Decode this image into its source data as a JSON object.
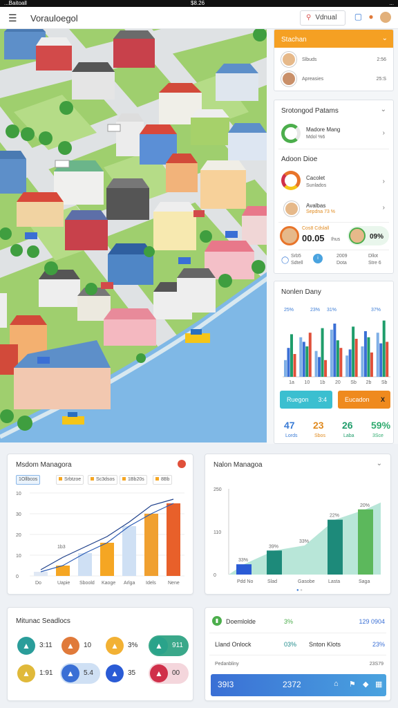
{
  "status": {
    "left": "...Baitoall",
    "center": "$8.26",
    "right": "..."
  },
  "appbar": {
    "title": "Vorauloegol",
    "search_label": "Vdnual",
    "menu_icon": "hamburger-icon",
    "search_icon": "search-icon"
  },
  "side": {
    "card1": {
      "title": "Stachan",
      "rows": [
        {
          "label": "Slbuds",
          "value": "2:56"
        },
        {
          "label": "Apreasies",
          "value": "25:S"
        }
      ]
    },
    "card2": {
      "title": "Srotongod Patams",
      "title2": "Adoon Dioe",
      "rows": [
        {
          "l1": "Madore Mang",
          "l2": "Mdol %6"
        },
        {
          "l1": "Cacolet",
          "l2": "Sunlados"
        },
        {
          "l1": "Avalbas",
          "l2": "Sepdna 73 %"
        }
      ],
      "time_label": "Cos8 Cdslall",
      "time_value": "00.05",
      "time_unit": "Ihus",
      "pct": "09%",
      "foot": [
        "Srb5",
        "Sdtell",
        "2009",
        "Dota",
        "Dllot",
        "Stre 6"
      ]
    },
    "card3": {
      "title": "Nonlen Dany",
      "toplabels": [
        "25%",
        "23%",
        "31%",
        "37%"
      ],
      "xlabels": [
        "1a",
        "10",
        "1b",
        "20",
        "Sb",
        "2b",
        "Sb"
      ],
      "btn1": "Ruegon",
      "btn1_val": "3:4",
      "btn2": "Eucadon",
      "btn2_val": "X",
      "stats": [
        {
          "num": "47",
          "lbl": "Lords",
          "color": "#3a7bd5"
        },
        {
          "num": "23",
          "lbl": "Sbos",
          "color": "#e08a1e"
        },
        {
          "num": "26",
          "lbl": "Laba",
          "color": "#1f9d6b"
        },
        {
          "num": "59%",
          "lbl": "3Sce",
          "color": "#2eaa6e"
        }
      ]
    }
  },
  "panel1": {
    "title": "Msdom Managora",
    "filters": [
      "1Ollbcos",
      "Srbtzoe",
      "Sc3dsos",
      "1Bb20s",
      "8Bb"
    ],
    "yticks": [
      "10",
      "30",
      "20",
      "10",
      "0"
    ],
    "categories": [
      "Do",
      "Uapie",
      "Sboold",
      "Kaoge",
      "Arlga",
      "Idels",
      "Nene"
    ],
    "datalabel": "1b3"
  },
  "panel2": {
    "title": "Nalon Managoa",
    "yticks": [
      "250",
      "110",
      "0"
    ],
    "categories": [
      "Pdd No",
      "Slad",
      "Gasobe",
      "Lasta",
      "Saga"
    ],
    "labels": [
      "33%",
      "39%",
      "33%",
      "22%",
      "20%"
    ]
  },
  "panel3": {
    "title": "Mitunac Seadlocs",
    "items": [
      {
        "v": "3:11",
        "c": "#2a9d9a"
      },
      {
        "v": "10",
        "c": "#e07a3a"
      },
      {
        "v": "3%",
        "c": "#f2b134"
      },
      {
        "v": "911",
        "c": "#2aa38a"
      },
      {
        "v": "1:91",
        "c": "#e0b93a"
      },
      {
        "v": "5.4",
        "c": "#3a6fd5"
      },
      {
        "v": "35",
        "c": "#2a5bd5"
      },
      {
        "v": "00",
        "c": "#d0304a"
      }
    ]
  },
  "panel4": {
    "row1_label": "Doemlolde",
    "row1_pct": "3%",
    "row1_val": "129 0904",
    "row2_label": "Lland Onlock",
    "row2_pct": "03%",
    "row2_label2": "Snton Klots",
    "row2_val": "23%",
    "foot_label": "Pedanbliny",
    "foot_val": "23S79",
    "bar_left": "39I3",
    "bar_mid": "2372"
  },
  "chart_data": [
    {
      "type": "bar",
      "title": "Nonlen Dany",
      "categories": [
        "1a",
        "10",
        "1b",
        "20",
        "Sb",
        "2b",
        "Sb"
      ],
      "series": [
        {
          "values": [
            22,
            52,
            34,
            62,
            28,
            40,
            58
          ]
        },
        {
          "values": [
            38,
            46,
            26,
            70,
            36,
            60,
            44
          ]
        },
        {
          "values": [
            56,
            40,
            64,
            48,
            66,
            52,
            74
          ]
        },
        {
          "values": [
            30,
            58,
            22,
            38,
            50,
            32,
            46
          ]
        }
      ],
      "ylim": [
        0,
        80
      ]
    },
    {
      "type": "bar",
      "title": "Msdom Managora",
      "categories": [
        "Do",
        "Uapie",
        "Sboold",
        "Kaoge",
        "Arlga",
        "Idels",
        "Nene"
      ],
      "series": [
        {
          "values": [
            2,
            5,
            11,
            16,
            24,
            30,
            35
          ]
        },
        {
          "values": [
            3,
            9,
            14,
            19,
            26,
            34,
            37
          ]
        }
      ],
      "ylim": [
        0,
        40
      ]
    },
    {
      "type": "area",
      "title": "Nalon Managoa",
      "categories": [
        "Pdd No",
        "Slad",
        "Gasobe",
        "Lasta",
        "Saga"
      ],
      "values": [
        30,
        70,
        85,
        160,
        190
      ],
      "ylim": [
        0,
        250
      ]
    }
  ],
  "colors": {
    "accent_orange": "#f5a023",
    "blue": "#3a7bd5",
    "teal": "#1d8a8a",
    "green": "#5cb85c"
  }
}
